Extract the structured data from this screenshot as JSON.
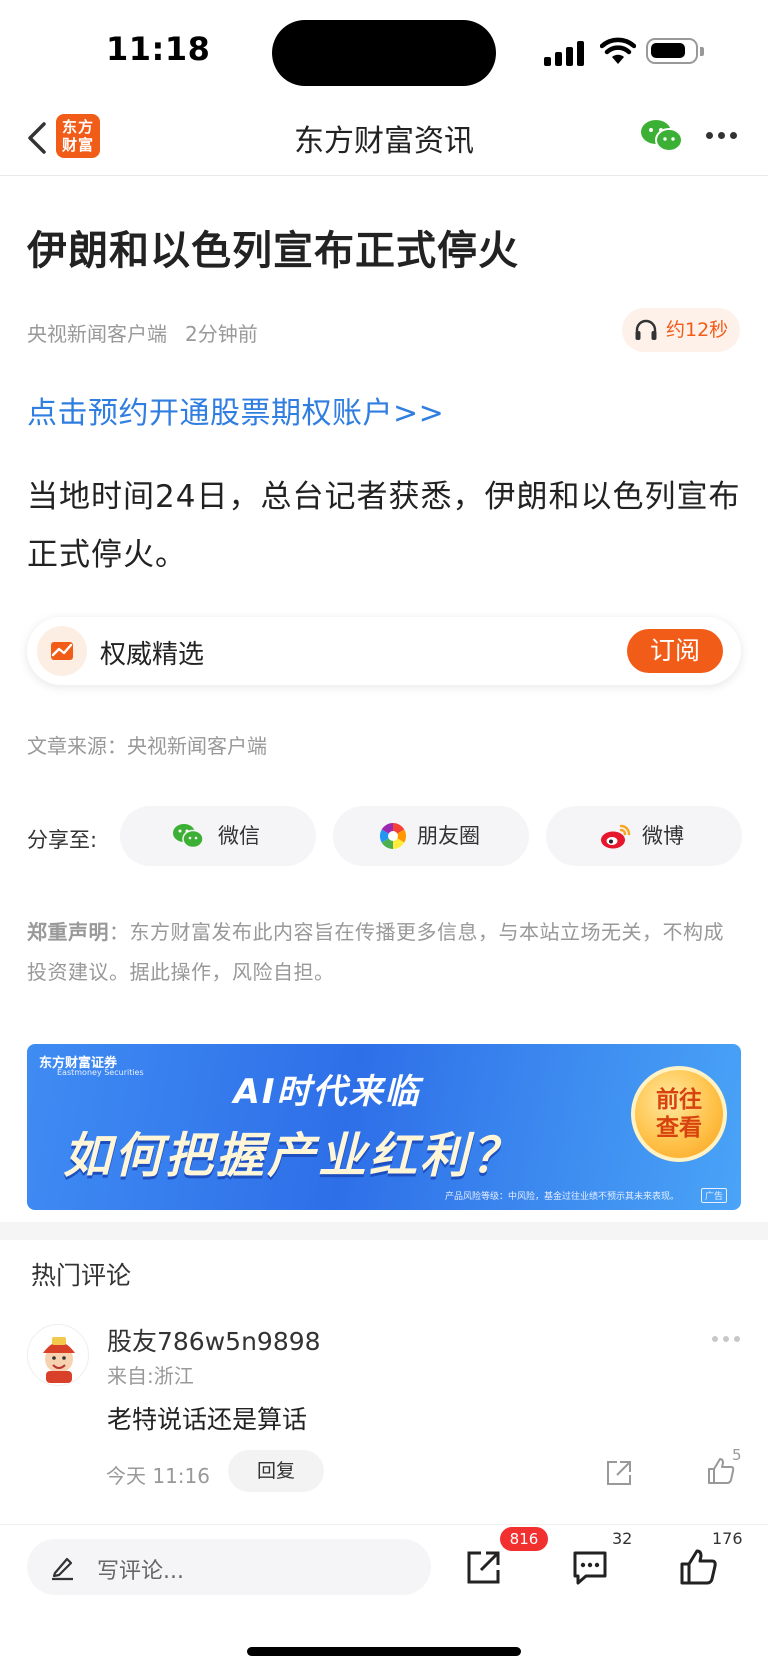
{
  "status_bar": {
    "time": "11:18"
  },
  "nav": {
    "logo_line1": "东方",
    "logo_line2": "财富",
    "title": "东方财富资讯"
  },
  "article": {
    "headline": "伊朗和以色列宣布正式停火",
    "source_name": "央视新闻客户端",
    "posted": "2分钟前",
    "listen_label": "约12秒",
    "promo_link": "点击预约开通股票期权账户>>",
    "body": "当地时间24日，总台记者获悉，伊朗和以色列宣布正式停火。",
    "subscribe": {
      "label": "权威精选",
      "button": "订阅"
    },
    "source_line": "文章来源：央视新闻客户端",
    "share": {
      "label": "分享至:",
      "targets": [
        "微信",
        "朋友圈",
        "微博"
      ]
    },
    "disclaimer_title": "郑重声明",
    "disclaimer_text": "：东方财富发布此内容旨在传播更多信息，与本站立场无关，不构成投资建议。据此操作，风险自担。"
  },
  "ad": {
    "brand": "东方财富证券",
    "brand_en": "Eastmoney Securities",
    "line1": "AI时代来临",
    "line2": "如何把握产业红利？",
    "cta_line1": "前往",
    "cta_line2": "查看",
    "risk": "产品风险等级：中风险，基金过往业绩不预示其未来表现。",
    "tag": "广告"
  },
  "comments": {
    "section_title": "热门评论",
    "items": [
      {
        "user": "股友786w5n9898",
        "location": "来自:浙江",
        "text": "老特说话还是算话",
        "time": "今天 11:16",
        "reply_label": "回复",
        "likes": "5"
      }
    ]
  },
  "bottom_bar": {
    "input_placeholder": "写评论...",
    "share_badge": "816",
    "comment_count": "32",
    "like_count": "176"
  },
  "colors": {
    "brand_orange": "#f25c19",
    "link_blue": "#2f7ee0",
    "badge_red": "#f23030",
    "wechat_green": "#3cb034"
  }
}
